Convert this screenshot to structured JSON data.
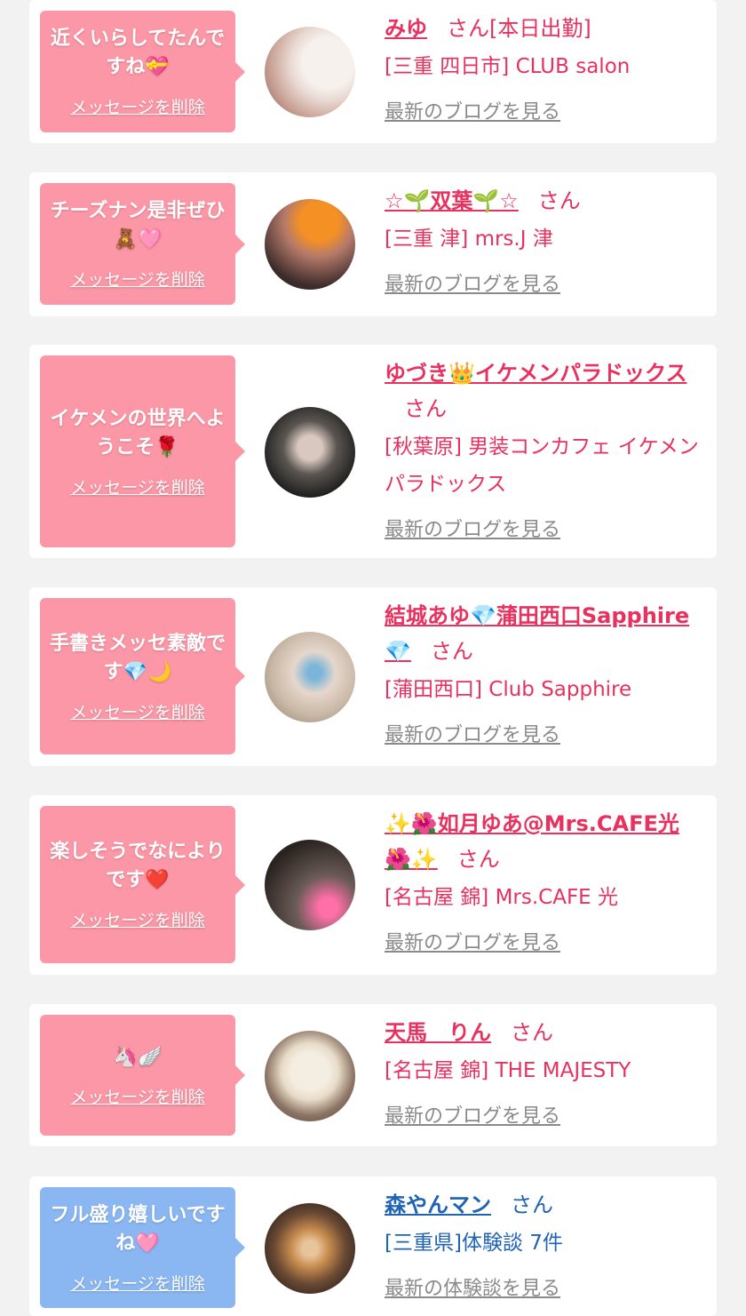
{
  "cards": [
    {
      "theme": "pink",
      "message": "近くいらしてたんですね💝",
      "delete_label": "メッセージを削除",
      "name": "みゆ",
      "san": "さん[本日出勤]",
      "shop": "[三重 四日市] CLUB salon",
      "blog": "最新のブログを見る",
      "avatar_colors": [
        "#d9b6a9",
        "#f7f1ee"
      ]
    },
    {
      "theme": "pink",
      "message": "チーズナン是非ぜひ🧸🩷",
      "delete_label": "メッセージを削除",
      "name": "☆🌱双葉🌱☆",
      "san": "さん",
      "shop": "[三重 津] mrs.J 津",
      "blog": "最新のブログを見る",
      "avatar_colors": [
        "#3b2a2a",
        "#f59024"
      ]
    },
    {
      "theme": "pink",
      "message": "イケメンの世界へようこそ🌹",
      "delete_label": "メッセージを削除",
      "name": "ゆづき👑イケメンパラドックス",
      "san": "さん",
      "shop": "[秋葉原] 男装コンカフェ イケメンパラドックス",
      "blog": "最新のブログを見る",
      "avatar_colors": [
        "#1c1c1c",
        "#5a5550"
      ]
    },
    {
      "theme": "pink",
      "message": "手書きメッセ素敵です💎🌙",
      "delete_label": "メッセージを削除",
      "name": "結城あゆ💎蒲田西口Sapphire💎",
      "san": "さん",
      "shop": "[蒲田西口] Club Sapphire",
      "blog": "最新のブログを見る",
      "avatar_colors": [
        "#c9b8a6",
        "#7bb6d9"
      ]
    },
    {
      "theme": "pink",
      "message": "楽しそうでなによりです❤️",
      "delete_label": "メッセージを削除",
      "name": "✨🌺如月ゆあ@Mrs.CAFE光🌺✨",
      "san": "さん",
      "shop": "[名古屋 錦] Mrs.CAFE 光",
      "blog": "最新のブログを見る",
      "avatar_colors": [
        "#2a2320",
        "#6a5b57"
      ]
    },
    {
      "theme": "pink",
      "message": "🦄🪽",
      "delete_label": "メッセージを削除",
      "name": "天馬　りん",
      "san": "さん",
      "shop": "[名古屋 錦] THE MAJESTY",
      "blog": "最新のブログを見る",
      "avatar_colors": [
        "#e8dcc8",
        "#4a3a32"
      ]
    },
    {
      "theme": "blue",
      "message": "フル盛り嬉しいですね🩷",
      "delete_label": "メッセージを削除",
      "name": "森やんマン",
      "san": "さん",
      "shop": "[三重県]体験談 7件",
      "blog": "最新の体験談を見る",
      "avatar_colors": [
        "#2b211c",
        "#c68b4d"
      ]
    }
  ]
}
